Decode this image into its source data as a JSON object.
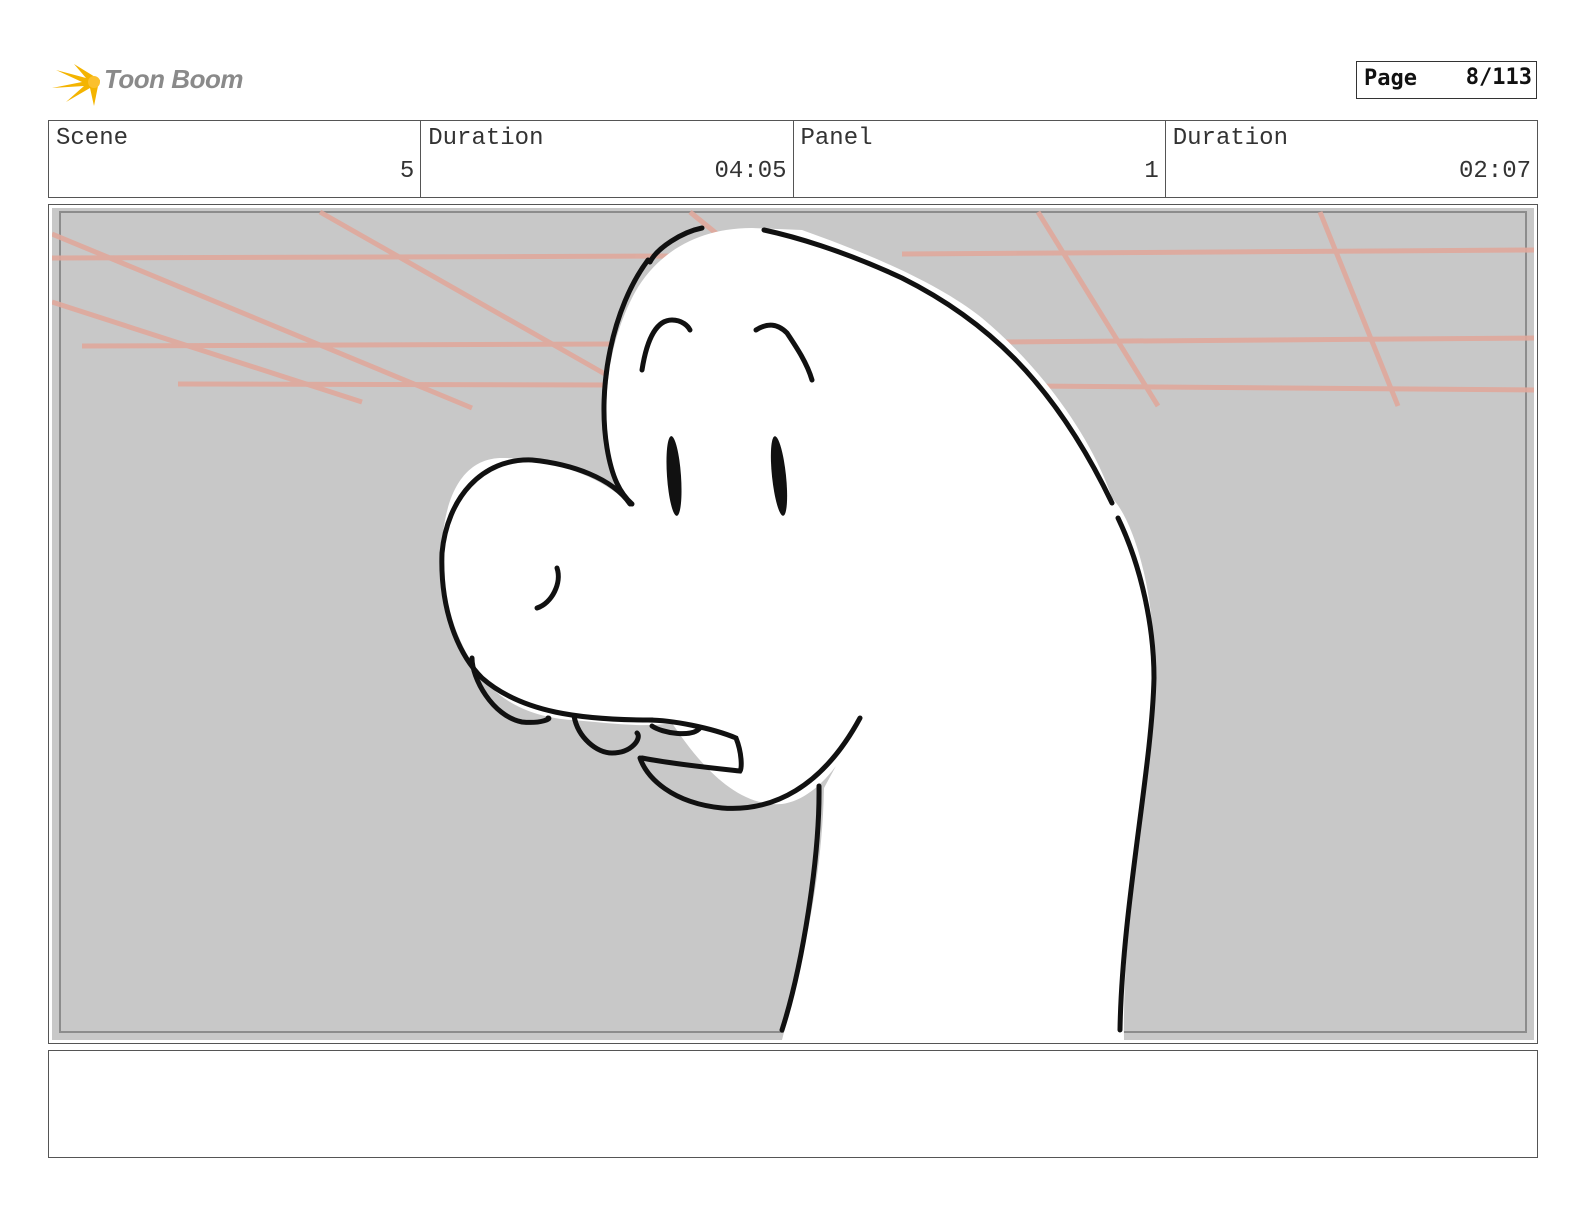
{
  "logo": {
    "text": "Toon Boom",
    "star_color": "#f4b400"
  },
  "page": {
    "label": "Page",
    "value": "8/113"
  },
  "header": {
    "scene_label": "Scene",
    "scene_value": "5",
    "scene_duration_label": "Duration",
    "scene_duration_value": "04:05",
    "panel_label": "Panel",
    "panel_value": "1",
    "panel_duration_label": "Duration",
    "panel_duration_value": "02:07"
  },
  "panel_image": {
    "background_color": "#c8c8c8",
    "grid_line_color": "#e0a89c",
    "character_fill": "#ffffff",
    "outline_color": "#111111"
  },
  "caption": {
    "text": ""
  }
}
